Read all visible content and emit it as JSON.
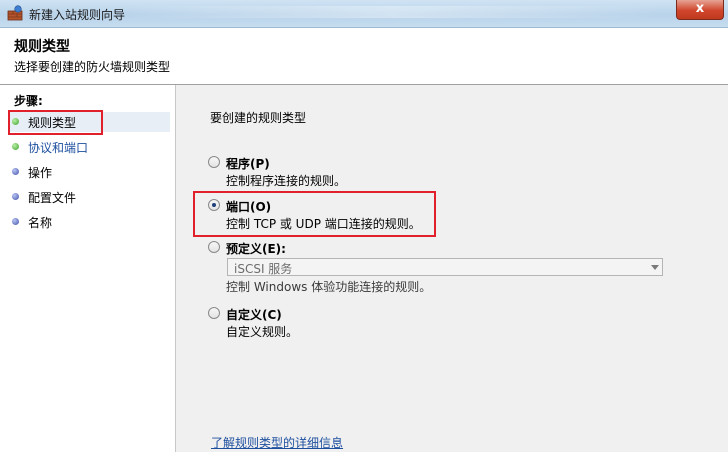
{
  "window": {
    "title": "新建入站规则向导",
    "close_label": "x"
  },
  "header": {
    "title": "规则类型",
    "subtitle": "选择要创建的防火墙规则类型"
  },
  "steps": {
    "title": "步骤:",
    "items": [
      {
        "label": "规则类型",
        "status": "current"
      },
      {
        "label": "协议和端口",
        "status": "next"
      },
      {
        "label": "操作",
        "status": "pending"
      },
      {
        "label": "配置文件",
        "status": "pending"
      },
      {
        "label": "名称",
        "status": "pending"
      }
    ]
  },
  "main": {
    "question": "要创建的规则类型",
    "options": [
      {
        "title": "程序(P)",
        "description": "控制程序连接的规则。",
        "selected": false
      },
      {
        "title": "端口(O)",
        "description": "控制 TCP 或 UDP 端口连接的规则。",
        "selected": true
      },
      {
        "title": "预定义(E):",
        "description": "控制 Windows 体验功能连接的规则。",
        "selected": false
      },
      {
        "title": "自定义(C)",
        "description": "自定义规则。",
        "selected": false
      }
    ],
    "predefined_select": {
      "value": "iSCSI 服务"
    },
    "help_link": "了解规则类型的详细信息"
  },
  "colors": {
    "highlight_box": "#e0202a",
    "link": "#1d4f9f",
    "close_button": "#d0462c"
  }
}
